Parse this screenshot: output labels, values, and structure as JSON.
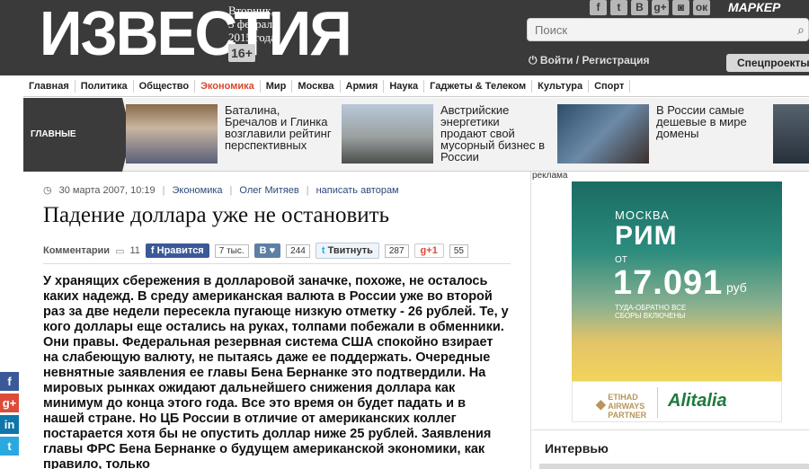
{
  "header": {
    "logo": "ИЗВЕСТИЯ",
    "date_line1": "Вторник,",
    "date_line2": "3 февраля",
    "date_line3": "2015 года",
    "age_rating": "16+",
    "social_icons": [
      "facebook-icon",
      "twitter-icon",
      "vk-icon",
      "google-plus-icon",
      "instagram-icon",
      "odnoklassniki-icon"
    ],
    "marker_link": "МАРКЕР",
    "search_placeholder": "Поиск",
    "login_label": "Войти / Регистрация",
    "special_projects": "Спецпроекты"
  },
  "nav": {
    "items": [
      "Главная",
      "Политика",
      "Общество",
      "Экономика",
      "Мир",
      "Москва",
      "Армия",
      "Наука",
      "Гаджеты & Телеком",
      "Культура",
      "Спорт"
    ],
    "active": "Экономика"
  },
  "top_news": {
    "label": "ГЛАВНЫЕ НОВОСТИ",
    "items": [
      {
        "text": "Баталина, Бречалов и Глинка возглавили рейтинг перспективных"
      },
      {
        "text": "Австрийские энергетики продают свой мусорный бизнес в России"
      },
      {
        "text": "В России самые дешевые в мире домены"
      }
    ]
  },
  "article": {
    "date": "30 марта 2007, 10:19",
    "section": "Экономика",
    "author": "Олег Митяев",
    "write_authors": "написать авторам",
    "title": "Падение доллара уже не остановить",
    "comments_label": "Комментарии",
    "comments_count": "11",
    "fb_label": "Нравится",
    "fb_count": "7 тыс.",
    "vk_label": "В",
    "vk_count": "244",
    "tw_label": "Твитнуть",
    "tw_count": "287",
    "gp_label": "+1",
    "gp_count": "55",
    "body": "У хранящих сбережения в долларовой заначке, похоже, не осталось каких надежд. В среду американская валюта в России уже во второй раз за две недели пересекла пугающе низкую отметку - 26 рублей. Те, у кого доллары еще остались на руках, толпами побежали в обменники. Они правы. Федеральная резервная система США спокойно взирает на слабеющую валюту, не пытаясь даже ее поддержать. Очередные невнятные заявления ее главы Бена Бернанке это подтвердили. На мировых рынках ожидают дальнейшего снижения доллара как минимум до конца этого года. Все это время он будет падать и в нашей стране. Но ЦБ России в отличие от американских коллег постарается хотя бы не опустить доллар ниже 25 рублей. Заявления главы ФРС Бена Бернанке о будущем американской экономики, как правило, только"
  },
  "sidebar_share": [
    "facebook-icon",
    "google-plus-icon",
    "linkedin-icon",
    "twitter-icon"
  ],
  "ad": {
    "label": "реклама",
    "city_from": "МОСКВА",
    "city_to": "РИМ",
    "from_label": "ОТ",
    "price": "17.091",
    "currency": "руб",
    "note": "ТУДА-ОБРАТНО ВСЕ СБОРЫ ВКЛЮЧЕНЫ",
    "partner1": "ETIHAD AIRWAYS PARTNER",
    "partner2": "Alitalia"
  },
  "interview_heading": "Интервью"
}
